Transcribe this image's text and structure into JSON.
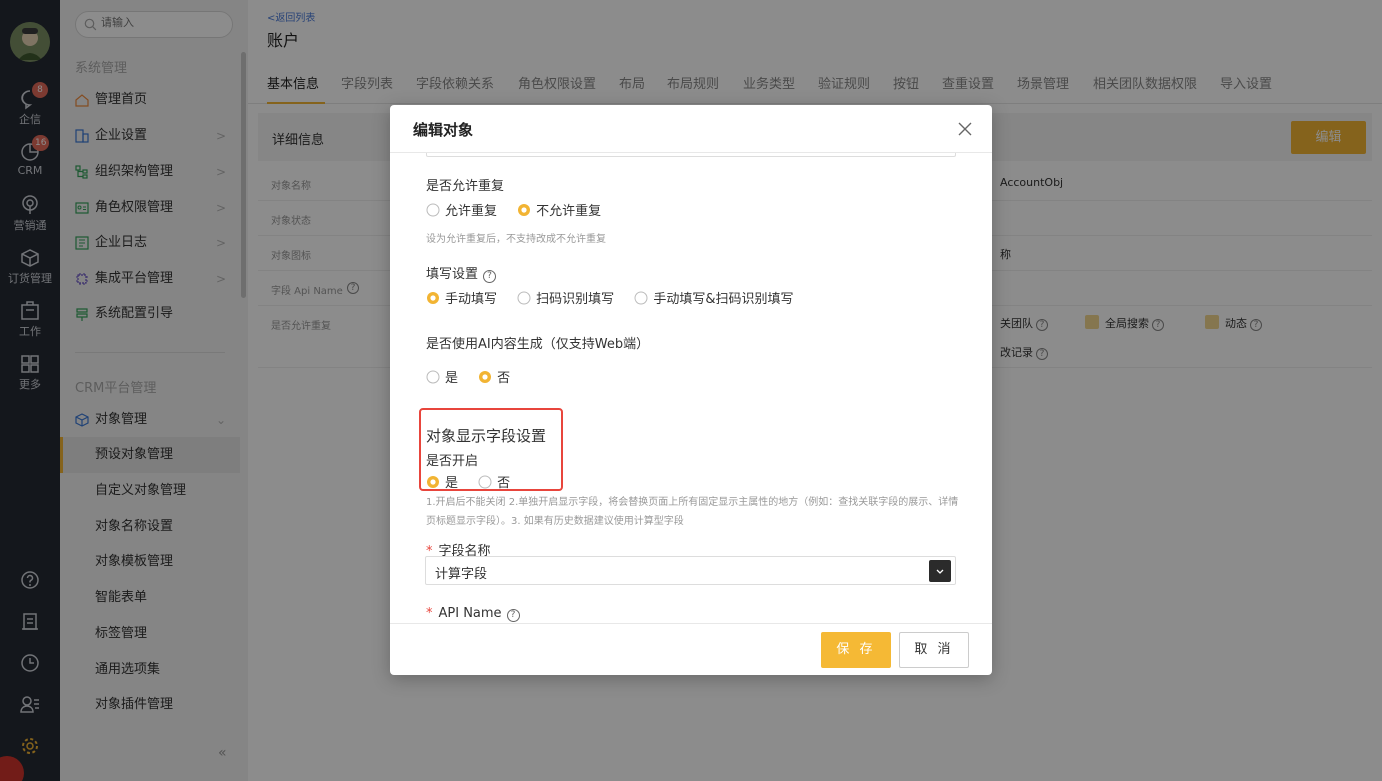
{
  "rail": {
    "items": [
      {
        "label": "企信",
        "badge": "8"
      },
      {
        "label": "CRM",
        "badge": "16"
      },
      {
        "label": "营销通"
      },
      {
        "label": "订货管理"
      },
      {
        "label": "工作"
      },
      {
        "label": "更多"
      }
    ]
  },
  "sidebar": {
    "search_placeholder": "请输入",
    "section1": "系统管理",
    "items": [
      {
        "label": "管理首页"
      },
      {
        "label": "企业设置"
      },
      {
        "label": "组织架构管理"
      },
      {
        "label": "角色权限管理"
      },
      {
        "label": "企业日志"
      },
      {
        "label": "集成平台管理"
      },
      {
        "label": "系统配置引导"
      }
    ],
    "section2": "CRM平台管理",
    "object_mgmt": "对象管理",
    "subitems": [
      {
        "label": "预设对象管理"
      },
      {
        "label": "自定义对象管理"
      },
      {
        "label": "对象名称设置"
      },
      {
        "label": "对象模板管理"
      },
      {
        "label": "智能表单"
      },
      {
        "label": "标签管理"
      },
      {
        "label": "通用选项集"
      },
      {
        "label": "对象插件管理"
      }
    ],
    "collapse": "«"
  },
  "main": {
    "back_link": "<返回列表",
    "title": "账户",
    "tabs": [
      "基本信息",
      "字段列表",
      "字段依赖关系",
      "角色权限设置",
      "布局",
      "布局规则",
      "业务类型",
      "验证规则",
      "按钮",
      "查重设置",
      "场景管理",
      "相关团队数据权限",
      "导入设置"
    ],
    "detail_title": "详细信息",
    "edit_label": "编辑",
    "rows": [
      {
        "label": "对象名称",
        "value": "AccountObj"
      },
      {
        "label": "对象状态",
        "value": ""
      },
      {
        "label": "对象图标",
        "value": "称"
      },
      {
        "label": "字段 Api Name",
        "value": ""
      },
      {
        "label": "是否允许重复",
        "value": ""
      }
    ],
    "options": {
      "team": "关团队",
      "global_search": "全局搜索",
      "dynamic": "动态",
      "change_log": "改记录"
    }
  },
  "modal": {
    "title": "编辑对象",
    "allow_dup": {
      "label": "是否允许重复",
      "options": [
        "允许重复",
        "不允许重复"
      ],
      "selected": 1,
      "hint": "设为允许重复后，不支持改成不允许重复"
    },
    "fill": {
      "label": "填写设置",
      "options": [
        "手动填写",
        "扫码识别填写",
        "手动填写&扫码识别填写"
      ],
      "selected": 0
    },
    "ai": {
      "label": "是否使用AI内容生成（仅支持Web端）",
      "options": [
        "是",
        "否"
      ],
      "selected": 1
    },
    "display_field": {
      "title": "对象显示字段设置",
      "label": "是否开启",
      "options": [
        "是",
        "否"
      ],
      "selected": 0,
      "hint": "1.开启后不能关闭 2.单独开启显示字段，将会替换页面上所有固定显示主属性的地方（例如：查找关联字段的展示、详情页标题显示字段）。3. 如果有历史数据建议使用计算型字段"
    },
    "field_name": {
      "label": "字段名称",
      "value": "计算字段"
    },
    "api_name": {
      "label": "API Name"
    },
    "save_label": "保 存",
    "cancel_label": "取 消"
  },
  "colors": {
    "accent": "#f2b433",
    "highlight": "#e8453c",
    "rail_bg": "#262a33"
  }
}
